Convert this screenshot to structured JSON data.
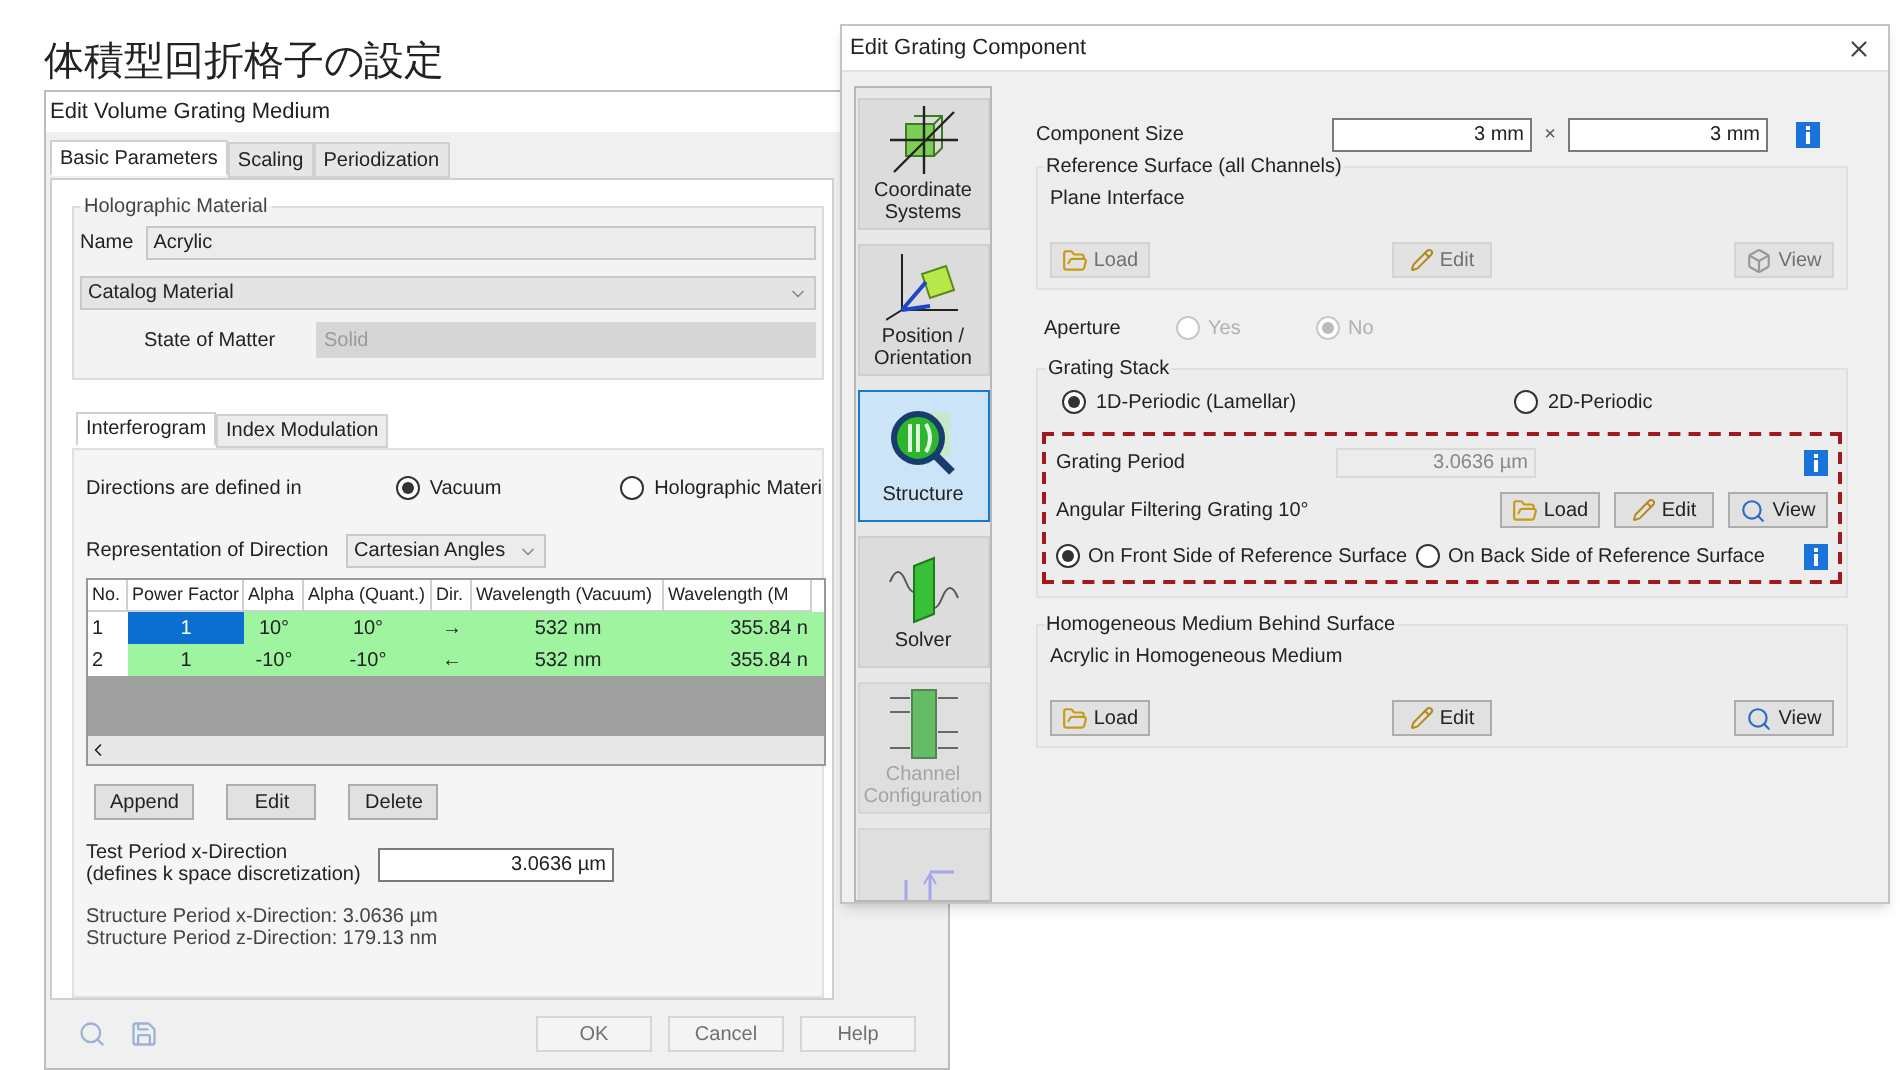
{
  "heading": "体積型回折格子の設定",
  "volume_dialog": {
    "title": "Edit Volume Grating Medium",
    "tabs": [
      {
        "label": "Basic Parameters",
        "selected": true
      },
      {
        "label": "Scaling",
        "selected": false
      },
      {
        "label": "Periodization",
        "selected": false
      }
    ],
    "material_group": {
      "title": "Holographic Material",
      "name_label": "Name",
      "name_value": "Acrylic",
      "catalog": "Catalog Material",
      "state_label": "State of Matter",
      "state_value": "Solid"
    },
    "inner_tabs": [
      {
        "label": "Interferogram",
        "selected": true
      },
      {
        "label": "Index Modulation",
        "selected": false
      }
    ],
    "directions": {
      "label": "Directions are defined in",
      "options": [
        {
          "label": "Vacuum",
          "selected": true
        },
        {
          "label": "Holographic Materi",
          "selected": false
        }
      ]
    },
    "representation": {
      "label": "Representation of Direction",
      "value": "Cartesian Angles"
    },
    "table": {
      "columns": [
        "No.",
        "Power Factor",
        "Alpha",
        "Alpha (Quant.)",
        "Dir.",
        "Wavelength (Vacuum)",
        "Wavelength (M"
      ],
      "rows": [
        {
          "cells": [
            {
              "text": "1",
              "selected": false
            },
            {
              "text": "1",
              "selected": true
            },
            {
              "text": "10°",
              "selected": false
            },
            {
              "text": "10°",
              "selected": false
            },
            {
              "text": "→",
              "selected": false
            },
            {
              "text": "532 nm",
              "selected": false
            },
            {
              "text": "355.84 n",
              "selected": false
            }
          ]
        },
        {
          "cells": [
            {
              "text": "2",
              "selected": false
            },
            {
              "text": "1",
              "selected": false
            },
            {
              "text": "-10°",
              "selected": false
            },
            {
              "text": "-10°",
              "selected": false
            },
            {
              "text": "←",
              "selected": false
            },
            {
              "text": "532 nm",
              "selected": false
            },
            {
              "text": "355.84 n",
              "selected": false
            }
          ]
        }
      ]
    },
    "buttons": [
      "Append",
      "Edit",
      "Delete"
    ],
    "test_period": {
      "label_lines": [
        "Test Period x-Direction",
        "(defines k space discretization)"
      ],
      "value": "3.0636 µm"
    },
    "structure_periods": [
      "Structure Period x-Direction: 3.0636 µm",
      "Structure Period z-Direction: 179.13 nm"
    ],
    "footer_buttons": [
      {
        "label": "OK",
        "disabled": true
      },
      {
        "label": "Cancel",
        "disabled": true
      },
      {
        "label": "Help",
        "disabled": true
      }
    ]
  },
  "grating_dialog": {
    "title": "Edit Grating Component",
    "sidebar": [
      {
        "kind": "coordinates",
        "label": "Coordinate Systems",
        "selected": false,
        "disabled": false
      },
      {
        "kind": "position",
        "label": "Position / Orientation",
        "selected": false,
        "disabled": false
      },
      {
        "kind": "structure",
        "label": "Structure",
        "selected": true,
        "disabled": false
      },
      {
        "kind": "solver",
        "label": "Solver",
        "selected": false,
        "disabled": false
      },
      {
        "kind": "channels",
        "label": "Channel Configuration",
        "selected": false,
        "disabled": true
      },
      {
        "kind": "fourier",
        "selected": false,
        "disabled": true
      }
    ],
    "component_size": {
      "label": "Component Size",
      "x": "3 mm",
      "separator": "×",
      "y": "3 mm"
    },
    "reference_surface": {
      "title": "Reference Surface (all Channels)",
      "value": "Plane Interface",
      "buttons": [
        {
          "kind": "load",
          "label": "Load",
          "disabled": true
        },
        {
          "kind": "edit",
          "label": "Edit",
          "disabled": true
        },
        {
          "kind": "view3d",
          "label": "View",
          "disabled": true
        }
      ]
    },
    "aperture": {
      "label": "Aperture",
      "options": [
        {
          "label": "Yes",
          "selected": false,
          "disabled": true
        },
        {
          "label": "No",
          "selected": true,
          "disabled": true
        }
      ]
    },
    "grating_stack": {
      "title": "Grating Stack",
      "options": [
        {
          "label": "1D-Periodic (Lamellar)",
          "selected": true
        },
        {
          "label": "2D-Periodic",
          "selected": false
        }
      ],
      "period_label": "Grating Period",
      "period_value": "3.0636 µm",
      "grating_name": "Angular Filtering Grating 10°",
      "buttons": [
        {
          "kind": "load",
          "label": "Load",
          "disabled": false
        },
        {
          "kind": "edit",
          "label": "Edit",
          "disabled": false
        },
        {
          "kind": "view",
          "label": "View",
          "disabled": false
        }
      ],
      "side_options": [
        {
          "label": "On Front Side of Reference Surface",
          "selected": true
        },
        {
          "label": "On Back Side of Reference Surface",
          "selected": false
        }
      ]
    },
    "homogeneous": {
      "title": "Homogeneous Medium Behind Surface",
      "value": "Acrylic in Homogeneous Medium",
      "buttons": [
        {
          "kind": "load",
          "label": "Load",
          "disabled": false
        },
        {
          "kind": "edit",
          "label": "Edit",
          "disabled": false
        },
        {
          "kind": "view",
          "label": "View",
          "disabled": false
        }
      ]
    }
  }
}
